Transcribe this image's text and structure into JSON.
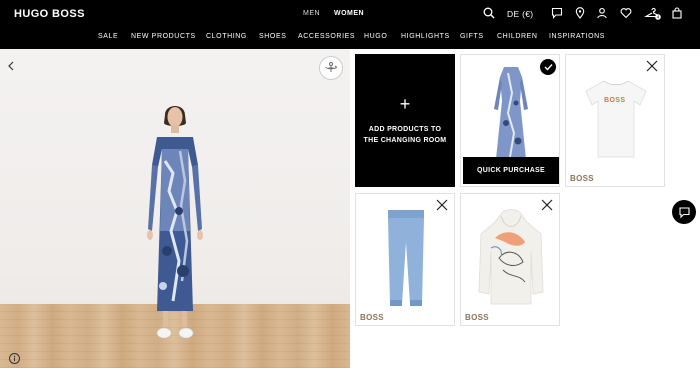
{
  "header": {
    "logo": "HUGO BOSS",
    "gender_tabs": [
      "MEN",
      "WOMEN"
    ],
    "active_gender": "WOMEN",
    "language": "DE (€)",
    "icons": [
      "search-icon",
      "chat-icon",
      "location-icon",
      "account-icon",
      "wishlist-icon",
      "hanger-icon",
      "bag-icon"
    ]
  },
  "nav": {
    "categories": [
      "SALE",
      "NEW PRODUCTS",
      "CLOTHING",
      "SHOES",
      "ACCESSORIES",
      "HUGO",
      "HIGHLIGHTS",
      "GIFTS",
      "CHILDREN",
      "INSPIRATIONS"
    ]
  },
  "changing_room": {
    "add_card": {
      "plus": "+",
      "line1": "ADD PRODUCTS TO",
      "line2": "THE CHANGING ROOM"
    },
    "quick_purchase": "QUICK PURCHASE",
    "products": [
      {
        "brand": "",
        "item": "printed maxi dress",
        "selected": true
      },
      {
        "brand": "BOSS",
        "item": "white logo t-shirt",
        "selected": false
      },
      {
        "brand": "BOSS",
        "item": "light blue jogger trousers",
        "selected": false
      },
      {
        "brand": "BOSS",
        "item": "printed hoodie",
        "selected": false
      }
    ],
    "tshirt_logo": "BOSS"
  },
  "colors": {
    "accent": "#000000",
    "brand_text": "#8d7657",
    "background": "#ffffff"
  }
}
